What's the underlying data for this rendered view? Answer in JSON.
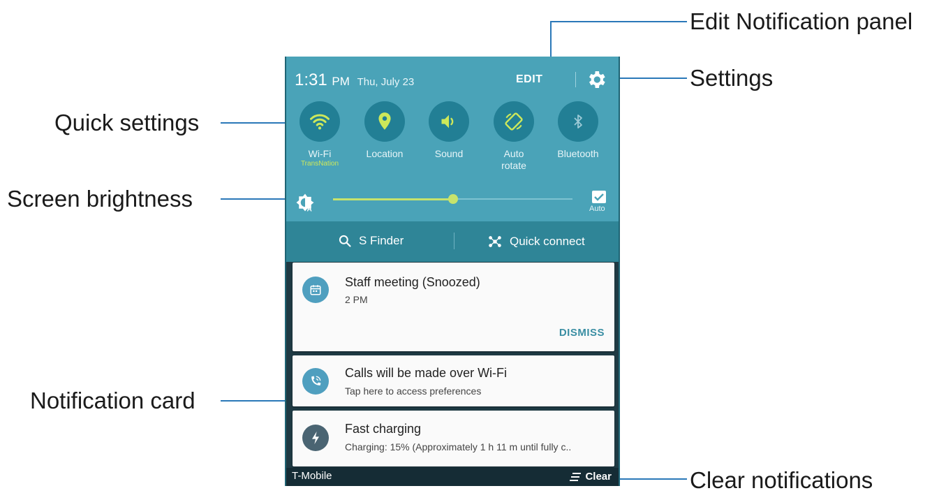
{
  "callouts": {
    "edit_notification_panel": "Edit Notification panel",
    "settings": "Settings",
    "quick_settings": "Quick settings",
    "screen_brightness": "Screen brightness",
    "notification_card": "Notification card",
    "clear_notifications": "Clear notifications"
  },
  "status": {
    "time": "1:31",
    "ampm": "PM",
    "date": "Thu, July 23",
    "edit_label": "EDIT"
  },
  "quick_settings": [
    {
      "label": "Wi-Fi",
      "sublabel": "TransNation",
      "icon": "wifi-icon"
    },
    {
      "label": "Location",
      "icon": "location-icon"
    },
    {
      "label": "Sound",
      "icon": "sound-icon"
    },
    {
      "label": "Auto",
      "label2": "rotate",
      "icon": "auto-rotate-icon"
    },
    {
      "label": "Bluetooth",
      "icon": "bluetooth-icon"
    }
  ],
  "brightness": {
    "level": 0.5,
    "auto_label": "Auto",
    "auto_checked": true
  },
  "finder": {
    "s_finder": "S Finder",
    "quick_connect": "Quick connect"
  },
  "notifications": [
    {
      "title": "Staff meeting (Snoozed)",
      "subtitle": "2 PM",
      "action": "DISMISS",
      "icon": "calendar-icon",
      "icon_color": "#4f9fbf"
    },
    {
      "title": "Calls will be made over Wi-Fi",
      "subtitle": "Tap here to access preferences",
      "icon": "wifi-call-icon",
      "icon_color": "#4f9fbf"
    },
    {
      "title": "Fast charging",
      "subtitle": "Charging: 15% (Approximately 1 h 11 m until fully c..",
      "icon": "lightning-icon",
      "icon_color": "#4a6472"
    }
  ],
  "bottom": {
    "carrier": "T-Mobile",
    "clear_label": "Clear"
  },
  "colors": {
    "accent_yellow": "#cde85a",
    "panel_teal": "#4aa3b8",
    "callout_line": "#2a78b8"
  }
}
